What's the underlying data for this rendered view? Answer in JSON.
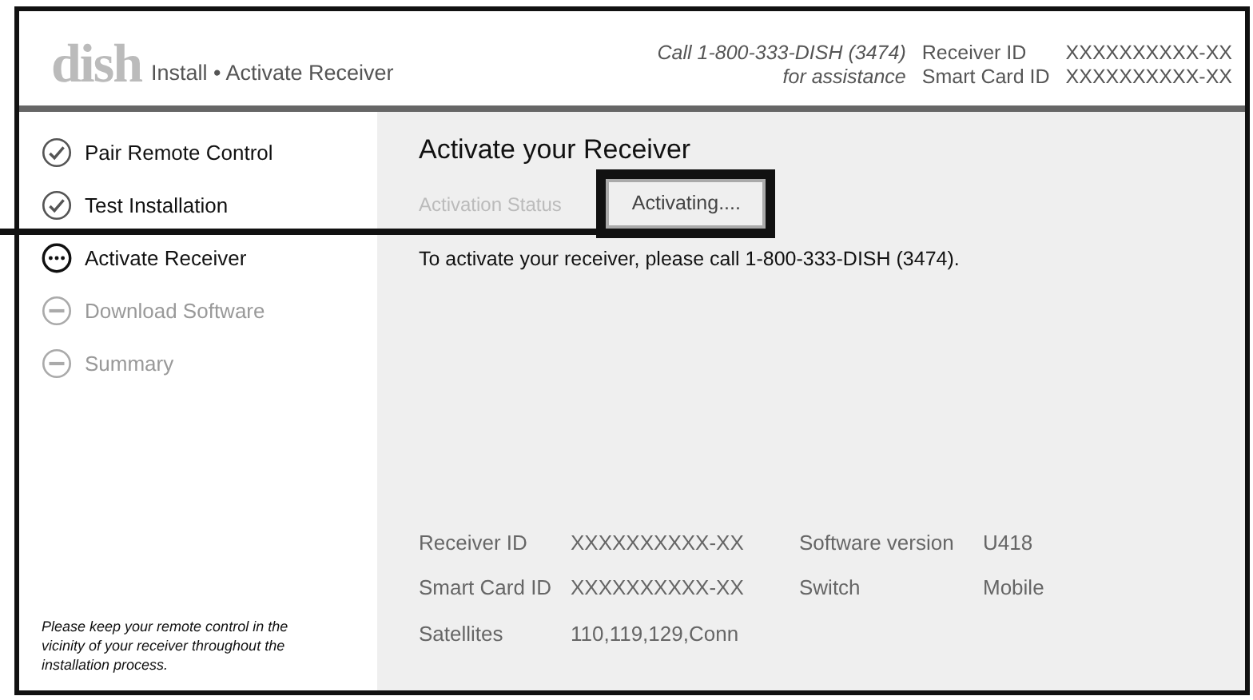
{
  "header": {
    "logo": "dish",
    "title": "Install • Activate Receiver",
    "assist_line1": "Call 1-800-333-DISH (3474)",
    "assist_line2": "for assistance",
    "ids": [
      {
        "label": "Receiver ID",
        "value": "XXXXXXXXXX-XX"
      },
      {
        "label": "Smart Card ID",
        "value": "XXXXXXXXXX-XX"
      }
    ]
  },
  "steps": [
    {
      "label": "Pair Remote Control",
      "kind": "done"
    },
    {
      "label": "Test Installation",
      "kind": "done"
    },
    {
      "label": "Activate Receiver",
      "kind": "current"
    },
    {
      "label": "Download Software",
      "kind": "pending"
    },
    {
      "label": "Summary",
      "kind": "pending"
    }
  ],
  "sidebar_note": "Please keep your remote control in the vicinity of your receiver throughout the installation process.",
  "main": {
    "title": "Activate your Receiver",
    "status_label": "Activation Status",
    "status_value": "Activating....",
    "message": "To activate your receiver, please call 1-800-333-DISH (3474).",
    "info": [
      [
        {
          "label": "Receiver ID",
          "value": "XXXXXXXXXX-XX"
        },
        {
          "label": "Software version",
          "value": "U418"
        }
      ],
      [
        {
          "label": "Smart Card ID",
          "value": "XXXXXXXXXX-XX"
        },
        {
          "label": "Switch",
          "value": "Mobile"
        }
      ],
      [
        {
          "label": "Satellites",
          "value": "110,119,129,Conn"
        }
      ]
    ]
  }
}
